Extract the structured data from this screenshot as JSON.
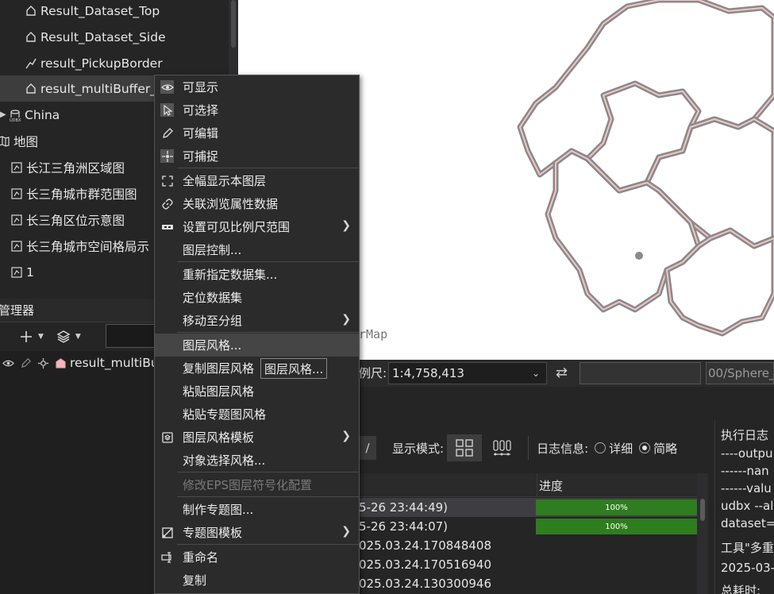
{
  "tree": {
    "items": [
      {
        "label": "Result_Dataset_Top",
        "icon": "region-icon"
      },
      {
        "label": "Result_Dataset_Side",
        "icon": "region-icon"
      },
      {
        "label": "result_PickupBorder",
        "icon": "line-icon"
      },
      {
        "label": "result_multiBuffer_",
        "icon": "region-icon"
      },
      {
        "label": "China",
        "icon": "udbx-datasource-icon"
      },
      {
        "label": "地图",
        "icon": "map-icon"
      },
      {
        "label": "长江三角洲区域图",
        "icon": "map-document-icon"
      },
      {
        "label": "长三角城市群范围图",
        "icon": "map-document-icon"
      },
      {
        "label": "长三角区位示意图",
        "icon": "map-document-icon"
      },
      {
        "label": "长三角城市空间格局示",
        "icon": "map-document-icon"
      },
      {
        "label": "1",
        "icon": "map-document-icon"
      }
    ]
  },
  "layer_manager": {
    "title": "管理器",
    "layer_name": "result_multiBu"
  },
  "map": {
    "watermark": "rMap",
    "fill_color": "#f2c4c4",
    "edge_color": "#8a8a8a"
  },
  "statusbar": {
    "scale_label": "例尺:",
    "scale_value": "1:4,758,413",
    "crs": "00/Sphere_M"
  },
  "task_panel": {
    "display_mode_label": "显示模式:",
    "log_label": "日志信息:",
    "log_options": [
      "详细",
      "简略"
    ],
    "log_selected": "简略",
    "progress_header": "进度",
    "rows": [
      {
        "text": "5-26 23:44:49)",
        "progress": "100%"
      },
      {
        "text": "5-26 23:44:07)",
        "progress": "100%"
      },
      {
        "text": "025.03.24.170848408",
        "progress": ""
      },
      {
        "text": "025.03.24.170516940",
        "progress": ""
      },
      {
        "text": "025.03.24.130300946",
        "progress": ""
      }
    ]
  },
  "exec_log": {
    "lines": [
      "执行日志",
      "----outpu",
      "------nan",
      "------valu",
      "udbx --al",
      "dataset=",
      "工具\"多重",
      "2025-03-",
      "总耗时:"
    ]
  },
  "context_menu": {
    "items": [
      {
        "label": "可显示",
        "icon": "eye-icon",
        "boxed": true
      },
      {
        "label": "可选择",
        "icon": "cursor-icon",
        "boxed": true
      },
      {
        "label": "可编辑",
        "icon": "pencil-icon"
      },
      {
        "label": "可捕捉",
        "icon": "snap-icon",
        "boxed": true
      },
      {
        "label": "全幅显示本图层",
        "icon": "full-extent-icon"
      },
      {
        "label": "关联浏览属性数据",
        "icon": "link-icon"
      },
      {
        "label": "设置可见比例尺范围",
        "icon": "scale-range-icon",
        "submenu": true
      },
      {
        "label": "图层控制...",
        "icon": ""
      },
      {
        "label": "重新指定数据集...",
        "icon": ""
      },
      {
        "label": "定位数据集",
        "icon": ""
      },
      {
        "label": "移动至分组",
        "icon": "",
        "submenu": true
      },
      {
        "label": "图层风格...",
        "icon": "",
        "hover": true
      },
      {
        "label": "复制图层风格",
        "icon": ""
      },
      {
        "label": "粘贴图层风格",
        "icon": ""
      },
      {
        "label": "粘贴专题图风格",
        "icon": ""
      },
      {
        "label": "图层风格模板",
        "icon": "style-template-icon",
        "submenu": true
      },
      {
        "label": "对象选择风格...",
        "icon": ""
      },
      {
        "label": "修改EPS图层符号化配置",
        "icon": "",
        "disabled": true
      },
      {
        "label": "制作专题图...",
        "icon": ""
      },
      {
        "label": "专题图模板",
        "icon": "thematic-template-icon",
        "submenu": true
      },
      {
        "label": "重命名",
        "icon": "rename-icon"
      },
      {
        "label": "复制",
        "icon": ""
      }
    ],
    "tooltip": "图层风格..."
  }
}
